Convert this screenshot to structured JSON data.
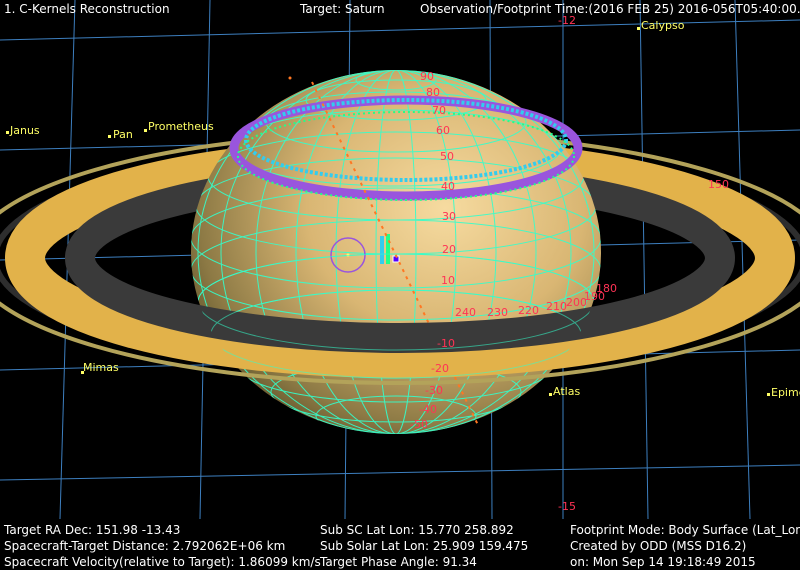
{
  "header": {
    "window_title": "1. C-Kernels Reconstruction",
    "target": "Target: Saturn",
    "observation_time": "Observation/Footprint Time:(2016 FEB 25) 2016-056T05:40:00.00"
  },
  "moons": [
    {
      "name": "Calypso"
    },
    {
      "name": "Janus"
    },
    {
      "name": "Pan"
    },
    {
      "name": "Prometheus"
    },
    {
      "name": "Mimas"
    },
    {
      "name": "Atlas"
    },
    {
      "name": "Epime"
    }
  ],
  "grid_labels": {
    "ra_top": "-12",
    "ra_bottom": "-15",
    "dec_right": "150",
    "lat_values": [
      "90",
      "80",
      "70",
      "60",
      "50",
      "40",
      "30",
      "20",
      "10",
      "0",
      "-10",
      "-20",
      "-30",
      "-40",
      "-50"
    ],
    "lon_values": [
      "240",
      "230",
      "220",
      "210",
      "200",
      "190",
      "180"
    ]
  },
  "footer": {
    "col1": [
      "Target RA Dec: 151.98  -13.43",
      "Spacecraft-Target Distance: 2.792062E+06 km",
      "Spacecraft Velocity(relative to Target): 1.86099 km/s"
    ],
    "col2": [
      "Sub SC Lat Lon: 15.770  258.892",
      "Sub Solar Lat Lon: 25.909  159.475",
      "Target Phase Angle: 91.34"
    ],
    "col3": [
      "Footprint Mode: Body Surface (Lat_Lon)",
      "Created by ODD (MSS D16.2)",
      "on: Mon Sep 14 19:18:49 2015"
    ]
  },
  "colors": {
    "background": "#000000",
    "grid": "#3d7fbf",
    "planet_light": "#f2d38f",
    "planet_dark": "#6b5a2c",
    "ring_main": "#e2b24a",
    "ring_dark": "#3a3a3a",
    "ring_thin": "#b3a35a",
    "lat_lon_grid": "#33ffcc",
    "purple_track": "#9955dd",
    "cyan_track": "#33ccee",
    "label_red": "#ff3355",
    "moon_yellow": "#ffff66",
    "footprint_orange": "#ff7722"
  }
}
